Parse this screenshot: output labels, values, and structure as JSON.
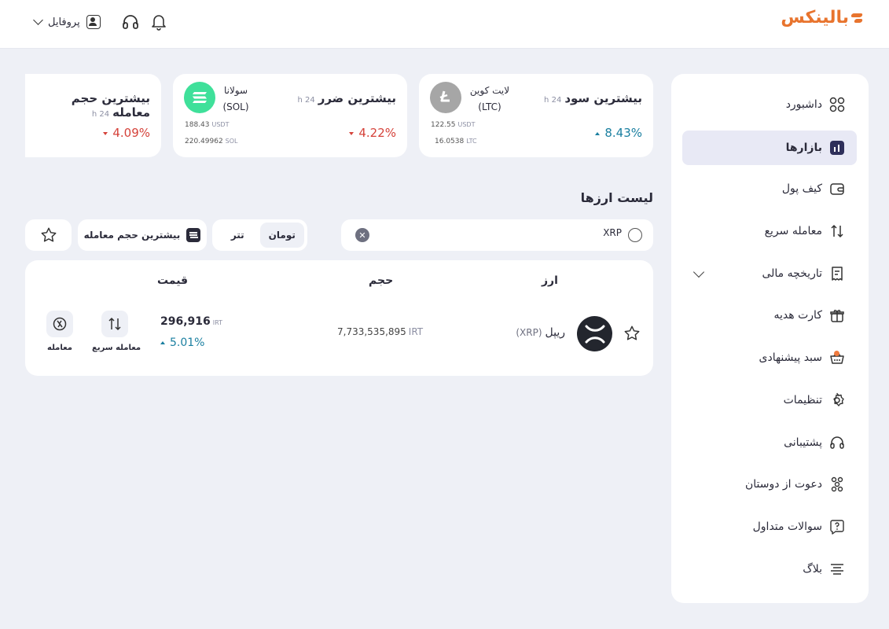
{
  "header": {
    "logo_text": "بالینکس",
    "profile_label": "پروفایل",
    "icons": [
      "chevron-down-icon",
      "avatar-icon",
      "headset-icon",
      "bell-icon"
    ]
  },
  "sidebar": {
    "items": [
      {
        "label": "داشبورد",
        "icon": "dashboard-grid-icon"
      },
      {
        "label": "بازارها",
        "icon": "chart-bar-icon",
        "active": true
      },
      {
        "label": "کیف پول",
        "icon": "wallet-icon"
      },
      {
        "label": "معامله سریع",
        "icon": "swap-arrows-icon"
      },
      {
        "label": "تاریخچه مالی",
        "icon": "receipt-icon",
        "expandable": true
      },
      {
        "label": "کارت هدیه",
        "icon": "gift-icon"
      },
      {
        "label": "سبد پیشنهادی",
        "icon": "basket-icon",
        "badge_dot": true
      },
      {
        "label": "تنظیمات",
        "icon": "gear-icon"
      },
      {
        "label": "پشتیبانی",
        "icon": "headset-icon"
      },
      {
        "label": "دعوت از دوستان",
        "icon": "users-icon"
      },
      {
        "label": "سوالات متداول",
        "icon": "question-icon"
      },
      {
        "label": "بلاگ",
        "icon": "lines-icon"
      }
    ]
  },
  "stats": {
    "top_gain": {
      "title": "بیشترین سود",
      "period": "24 h",
      "change": "8.43%",
      "coin_name": "لایت کوین",
      "coin_symbol": "(LTC)",
      "usdt_amount": "122.55",
      "usdt_unit": "USDT",
      "coin_amount": "16.0538",
      "coin_unit": "LTC",
      "logo_color": "#a6a6a6"
    },
    "top_loss": {
      "title": "بیشترین ضرر",
      "period": "24 h",
      "change": "4.22%",
      "coin_name": "سولانا",
      "coin_symbol": "(SOL)",
      "usdt_amount": "188.43",
      "usdt_unit": "USDT",
      "coin_amount": "220.49962",
      "coin_unit": "SOL",
      "logo_color": "#3fe09a"
    },
    "top_volume": {
      "title": "بیشترین حجم معامله",
      "period": "24 h",
      "change": "4.09%"
    }
  },
  "market": {
    "section_title": "لیست ارزها",
    "search_value": "XRP",
    "currency_options": [
      "تومان",
      "تتر"
    ],
    "selected_currency": "تومان",
    "sort_label": "بیشترین حجم معامله",
    "columns": {
      "asset": "ارز",
      "volume": "حجم",
      "price": "قیمت"
    },
    "rows": [
      {
        "name": "ریپل",
        "symbol": "(XRP)",
        "volume": "7,733,535,895",
        "volume_unit": "IRT",
        "price": "296,916",
        "price_unit": "IRT",
        "change": "5.01%",
        "quick_trade_label": "معامله سریع",
        "trade_label": "معامله"
      }
    ]
  },
  "colors": {
    "brand": "#e8742e",
    "positive": "#1a7fa0",
    "negative": "#d5423a",
    "active_menu_bg": "#e8e9f5"
  }
}
